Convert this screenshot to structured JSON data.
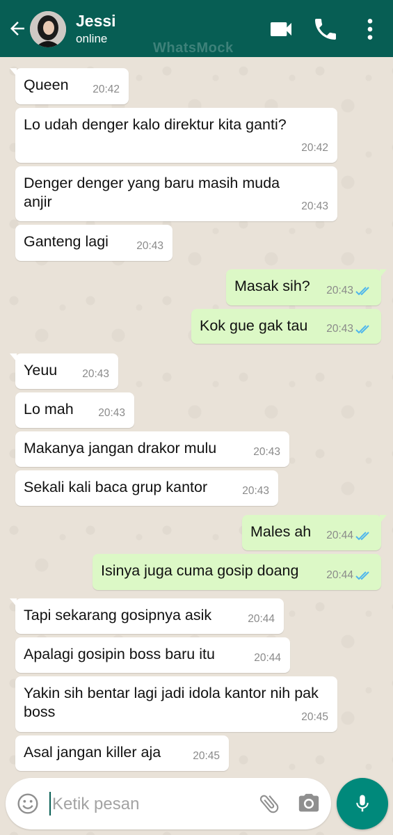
{
  "header": {
    "contact_name": "Jessi",
    "status": "online",
    "watermark": "WhatsMock",
    "color": "#075e54"
  },
  "messages": [
    {
      "dir": "in",
      "text": "Queen",
      "time": "20:42"
    },
    {
      "dir": "in",
      "text": "Lo udah denger kalo direktur kita ganti?",
      "time": "20:42"
    },
    {
      "dir": "in",
      "text": "Denger denger yang baru masih muda anjir",
      "time": "20:43"
    },
    {
      "dir": "in",
      "text": "Ganteng lagi",
      "time": "20:43"
    },
    {
      "dir": "out",
      "text": "Masak sih?",
      "time": "20:43",
      "read": true
    },
    {
      "dir": "out",
      "text": "Kok gue gak tau",
      "time": "20:43",
      "read": true
    },
    {
      "dir": "in",
      "text": "Yeuu",
      "time": "20:43"
    },
    {
      "dir": "in",
      "text": "Lo mah",
      "time": "20:43"
    },
    {
      "dir": "in",
      "text": "Makanya jangan drakor mulu",
      "time": "20:43"
    },
    {
      "dir": "in",
      "text": "Sekali kali baca grup kantor",
      "time": "20:43"
    },
    {
      "dir": "out",
      "text": "Males ah",
      "time": "20:44",
      "read": true
    },
    {
      "dir": "out",
      "text": "Isinya juga cuma gosip doang",
      "time": "20:44",
      "read": true
    },
    {
      "dir": "in",
      "text": "Tapi sekarang gosipnya asik",
      "time": "20:44"
    },
    {
      "dir": "in",
      "text": "Apalagi gosipin boss baru itu",
      "time": "20:44"
    },
    {
      "dir": "in",
      "text": "Yakin sih bentar lagi jadi idola kantor nih pak boss",
      "time": "20:45"
    },
    {
      "dir": "in",
      "text": "Asal jangan killer aja",
      "time": "20:45"
    }
  ],
  "input": {
    "placeholder": "Ketik pesan"
  },
  "colors": {
    "incoming_bubble": "#ffffff",
    "outgoing_bubble": "#dcf8c6",
    "read_tick": "#4fb6ec",
    "mic_button": "#00897b"
  },
  "icons": [
    "back-arrow-icon",
    "video-call-icon",
    "phone-icon",
    "more-vert-icon",
    "emoji-icon",
    "attach-icon",
    "camera-icon",
    "mic-icon"
  ]
}
